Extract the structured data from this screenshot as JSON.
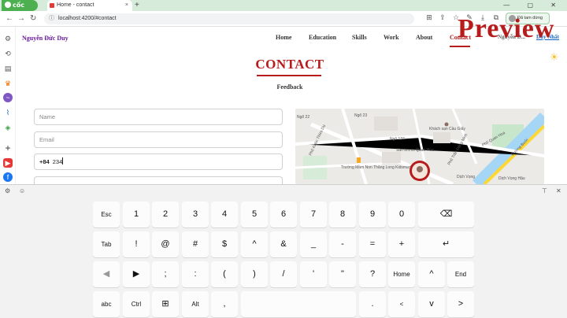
{
  "browser": {
    "brand": "cốc cốc",
    "tab_title": "Home - contact",
    "tab_close": "×",
    "new_tab": "+",
    "window_controls": "— ▢ ✕",
    "url": "localhost:4200/#contact",
    "login_label": "Đã tam dừng"
  },
  "sidebar": {
    "icons": [
      "gear-icon",
      "history-icon",
      "notes-icon",
      "crown-icon",
      "messenger-icon",
      "chart-icon",
      "gamepad-icon",
      "add-icon",
      "youtube-icon",
      "facebook-icon"
    ]
  },
  "site": {
    "name": "Nguyễn Đức Duy",
    "nav": [
      "Home",
      "Education",
      "Skills",
      "Work",
      "About",
      "Contact",
      "Nguyễn D...",
      "Duy Nhất"
    ],
    "active_nav": "Contact",
    "overlay_watermark": "Preview"
  },
  "contact": {
    "title": "CONTACT",
    "subtitle": "Feedback",
    "name_placeholder": "Name",
    "email_placeholder": "Email",
    "phone_code": "+84",
    "phone_value": "234"
  },
  "map": {
    "labels": [
      "Ngõ 22",
      "Khách sạn Cầu Giấy",
      "Phố Khúc Thừa Dụ",
      "Ngõ 23",
      "Sân tennis Quan Hoa",
      "Phố Quan Hoa",
      "Trường Mầm Non Thăng Long Kidsmart",
      "Ngõ 127",
      "Đường Bưởi",
      "Phố Trần Đăng Ninh",
      "Dịch Vọng",
      "Dịch Vọng Hậu"
    ]
  },
  "keyboard": {
    "rows": [
      [
        "Esc",
        "1",
        "2",
        "3",
        "4",
        "5",
        "6",
        "7",
        "8",
        "9",
        "0",
        "⌫"
      ],
      [
        "Tab",
        "!",
        "@",
        "#",
        "$",
        "^",
        "&",
        "_",
        "-",
        "=",
        "+",
        "↵"
      ],
      [
        "◀",
        "▶",
        ";",
        ":",
        "(",
        ")",
        "/",
        "'",
        "\"",
        "?",
        "Home",
        "^",
        "End"
      ],
      [
        "abc",
        "Ctrl",
        "⊞",
        "Alt",
        ",",
        "",
        ".",
        " <",
        "v",
        ">"
      ]
    ]
  },
  "colors": {
    "accent": "#b71c1c",
    "brand_green": "#4caf50",
    "site_name": "#6a1b9a"
  }
}
